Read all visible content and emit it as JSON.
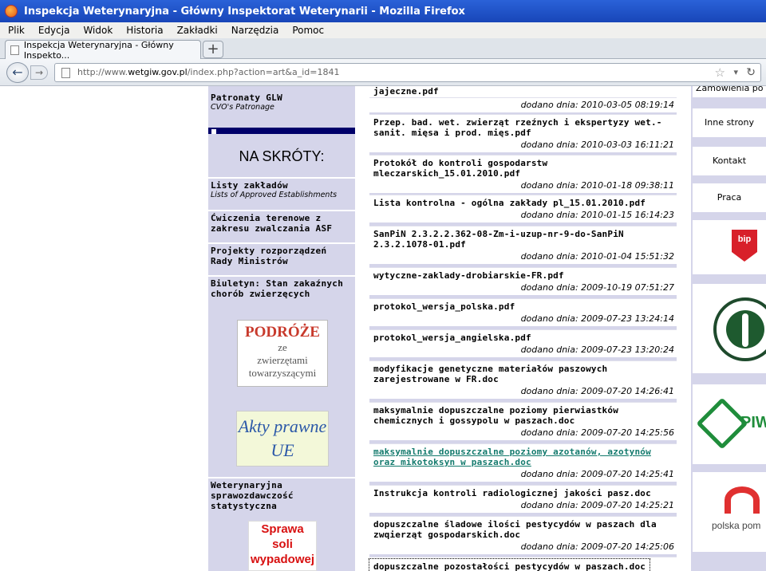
{
  "window": {
    "title": "Inspekcja Weterynaryjna - Główny Inspektorat Weterynarii - Mozilla Firefox"
  },
  "menu": [
    "Plik",
    "Edycja",
    "Widok",
    "Historia",
    "Zakładki",
    "Narzędzia",
    "Pomoc"
  ],
  "tab": {
    "title": "Inspekcja Weterynaryjna - Główny Inspekto...",
    "new_tab": "+"
  },
  "address": {
    "prefix": "http://www.",
    "domain": "wetgiw.gov.pl",
    "path": "/index.php?action=art&a_id=1841"
  },
  "left_nav": {
    "patronaty": {
      "pl": "Patronaty GLW",
      "en": "CVO's Patronage"
    },
    "skroty": "NA SKRÓTY:",
    "items": [
      {
        "pl": "Listy zakładów",
        "en": "Lists of Approved Establishments"
      },
      {
        "pl": "Ćwiczenia terenowe z zakresu zwalczania ASF",
        "en": ""
      },
      {
        "pl": "Projekty rozporządzeń Rady Ministrów",
        "en": ""
      },
      {
        "pl": "Biuletyn: Stan zakaźnych chorób zwierzęcych",
        "en": ""
      }
    ],
    "podroze": {
      "line1": "PODRÓŻE",
      "line2": "ze",
      "line3": "zwierzętami",
      "line4": "towarzyszącymi"
    },
    "akty": {
      "line1": "Akty prawne",
      "line2": "UE"
    },
    "sprawozdawczosc": "Weterynaryjna sprawozdawczość statystyczna",
    "sprawa": {
      "line1": "Sprawa",
      "line2": "soli",
      "line3": "wypadowej"
    }
  },
  "files": [
    {
      "name": "jajeczne.pdf",
      "date": ""
    },
    {
      "name": "",
      "date": "dodano dnia: 2010-03-05 08:19:14"
    },
    {
      "name": "Przep. bad. wet. zwierząt rzeźnych i ekspertyzy wet.-sanit. mięsa i prod. mięs.pdf",
      "date": "dodano dnia: 2010-03-03 16:11:21"
    },
    {
      "name": "Protokół do kontroli gospodarstw mleczarskich_15.01.2010.pdf",
      "date": "dodano dnia: 2010-01-18 09:38:11"
    },
    {
      "name": "Lista kontrolna - ogólna zakłady pl_15.01.2010.pdf",
      "date": "dodano dnia: 2010-01-15 16:14:23"
    },
    {
      "name": "SanPiN 2.3.2.2.362-08-Zm-i-uzup-nr-9-do-SanPiN 2.3.2.1078-01.pdf",
      "date": "dodano dnia: 2010-01-04 15:51:32"
    },
    {
      "name": "wytyczne-zaklady-drobiarskie-FR.pdf",
      "date": "dodano dnia: 2009-10-19 07:51:27"
    },
    {
      "name": "protokol_wersja_polska.pdf",
      "date": "dodano dnia: 2009-07-23 13:24:14"
    },
    {
      "name": "protokol_wersja_angielska.pdf",
      "date": "dodano dnia: 2009-07-23 13:20:24"
    },
    {
      "name": "modyfikacje genetyczne materiałów paszowych zarejestrowane w FR.doc",
      "date": "dodano dnia: 2009-07-20 14:26:41"
    },
    {
      "name": "maksymalnie dopuszczalne poziomy pierwiastków chemicznych i gossypolu w paszach.doc",
      "date": "dodano dnia: 2009-07-20 14:25:56"
    },
    {
      "name": "maksymalnie dopuszczalne poziomy azotanów, azotynów oraz mikotoksyn w paszach.doc",
      "date": "dodano dnia: 2009-07-20 14:25:41"
    },
    {
      "name": "Instrukcja kontroli radiologicznej jakości pasz.doc",
      "date": "dodano dnia: 2009-07-20 14:25:21"
    },
    {
      "name": "dopuszczalne śladowe ilości pestycydów w paszach dla zwqierząt gospodarskich.doc",
      "date": "dodano dnia: 2009-07-20 14:25:06"
    },
    {
      "name": "dopuszczalne pozostałości pestycydów w paszach.doc",
      "date": ""
    }
  ],
  "right_nav": {
    "zamowienia": "Zamówienia po",
    "inne": "Inne strony",
    "kontakt": "Kontakt",
    "praca": "Praca",
    "bip": "bip",
    "piw": "PIW",
    "polska": "polska pom"
  },
  "colors": {
    "panel": "#d5d5ea",
    "header": "#00006a",
    "link": "#137a6d"
  }
}
